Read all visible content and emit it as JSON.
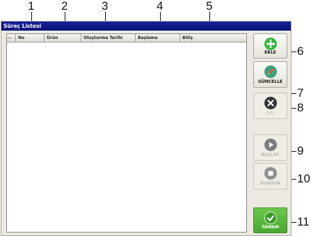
{
  "window": {
    "title": "Süreç Listesi"
  },
  "columns": [
    {
      "label": "..."
    },
    {
      "label": "No"
    },
    {
      "label": "Ürün"
    },
    {
      "label": "Oluşturma Tarihi"
    },
    {
      "label": "Başlama"
    },
    {
      "label": "Bitiş"
    }
  ],
  "buttons": {
    "add": "EKLE",
    "update": "GÜNCELLE",
    "delete": "SİL",
    "start": "BAŞLAT",
    "stop": "DURDUR",
    "ok": "TAMAM"
  },
  "callouts": [
    "1",
    "2",
    "3",
    "4",
    "5",
    "6",
    "7",
    "8",
    "9",
    "10",
    "11"
  ],
  "colors": {
    "titlebar": "#0a1278",
    "add_icon": "#3cb843",
    "update_icon": "#3aa37b",
    "delete_icon": "#333333",
    "disabled_icon": "#8a8a8a",
    "ok_button": "#58b93e"
  }
}
